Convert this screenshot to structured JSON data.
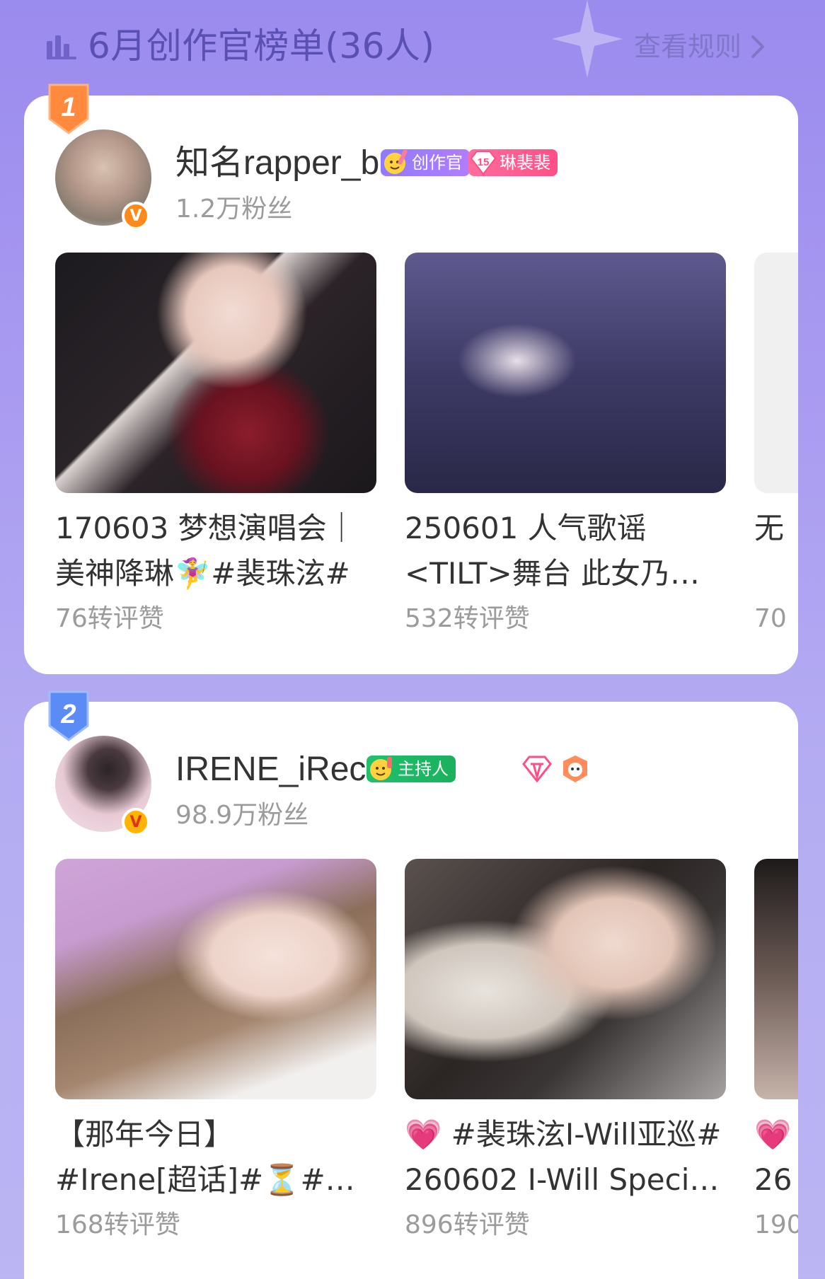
{
  "header": {
    "title": "6月创作官榜单(36人)",
    "rules_label": "查看规则"
  },
  "cards": [
    {
      "rank": "1",
      "rank_color": "#ff8a3d",
      "username": "知名rapper_bae",
      "fans": "1.2万粉丝",
      "role_badge": "创作官",
      "fan_badge_level": "15",
      "fan_badge_name": "琳裴裴",
      "posts": [
        {
          "title_line1": "170603 梦想演唱会｜",
          "title_line2": "美神降琳🧚‍♀️#裴珠泫#",
          "stats": "76转评赞"
        },
        {
          "title_line1": "250601 人气歌谣",
          "title_line2": "<TILT>舞台 此女乃…",
          "stats": "532转评赞"
        },
        {
          "title_line1": "无",
          "title_line2": "",
          "stats": "70"
        }
      ]
    },
    {
      "rank": "2",
      "rank_color": "#5b8cf5",
      "username": "IRENE_iRecord",
      "fans": "98.9万粉丝",
      "role_badge": "主持人",
      "posts": [
        {
          "title_line1": "【那年今日】",
          "title_line2": "#Irene[超话]#⏳#与…",
          "stats": "168转评赞"
        },
        {
          "title_line1": "💗 #裴珠泫I-Will亚巡#",
          "title_line2": "260602 I-Will Speci…",
          "stats": "896转评赞"
        },
        {
          "title_line1": "💗",
          "title_line2": "26",
          "stats": "190"
        }
      ]
    }
  ]
}
